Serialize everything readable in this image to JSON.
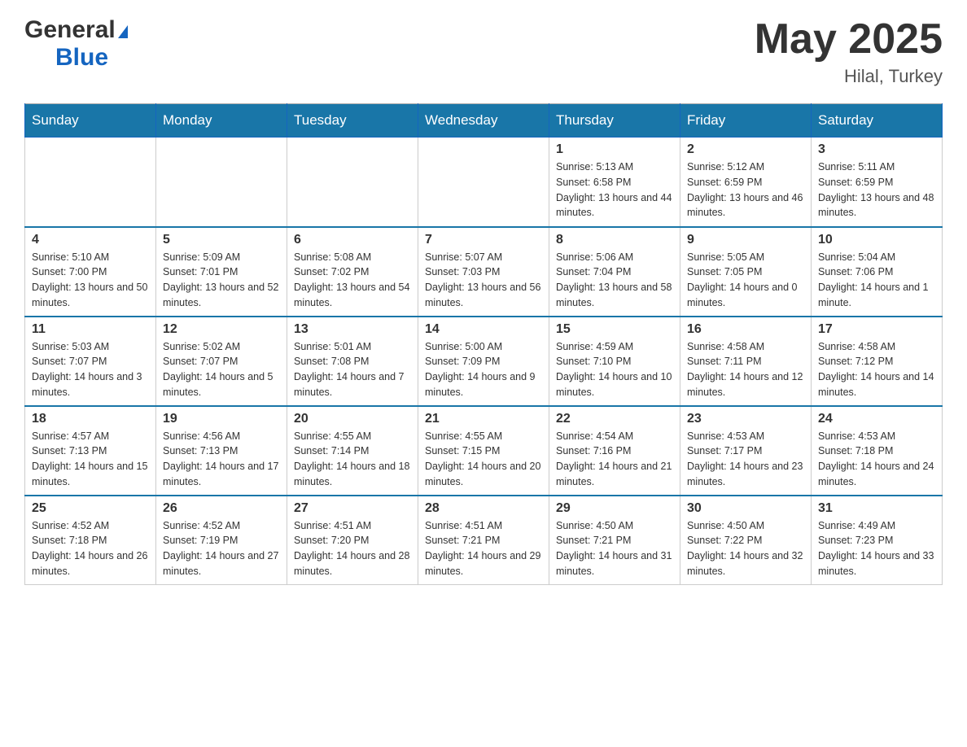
{
  "logo": {
    "general": "General",
    "blue": "Blue",
    "tagline": ""
  },
  "title": {
    "month_year": "May 2025",
    "location": "Hilal, Turkey"
  },
  "weekdays": [
    "Sunday",
    "Monday",
    "Tuesday",
    "Wednesday",
    "Thursday",
    "Friday",
    "Saturday"
  ],
  "weeks": [
    [
      {
        "day": "",
        "sunrise": "",
        "sunset": "",
        "daylight": ""
      },
      {
        "day": "",
        "sunrise": "",
        "sunset": "",
        "daylight": ""
      },
      {
        "day": "",
        "sunrise": "",
        "sunset": "",
        "daylight": ""
      },
      {
        "day": "",
        "sunrise": "",
        "sunset": "",
        "daylight": ""
      },
      {
        "day": "1",
        "sunrise": "Sunrise: 5:13 AM",
        "sunset": "Sunset: 6:58 PM",
        "daylight": "Daylight: 13 hours and 44 minutes."
      },
      {
        "day": "2",
        "sunrise": "Sunrise: 5:12 AM",
        "sunset": "Sunset: 6:59 PM",
        "daylight": "Daylight: 13 hours and 46 minutes."
      },
      {
        "day": "3",
        "sunrise": "Sunrise: 5:11 AM",
        "sunset": "Sunset: 6:59 PM",
        "daylight": "Daylight: 13 hours and 48 minutes."
      }
    ],
    [
      {
        "day": "4",
        "sunrise": "Sunrise: 5:10 AM",
        "sunset": "Sunset: 7:00 PM",
        "daylight": "Daylight: 13 hours and 50 minutes."
      },
      {
        "day": "5",
        "sunrise": "Sunrise: 5:09 AM",
        "sunset": "Sunset: 7:01 PM",
        "daylight": "Daylight: 13 hours and 52 minutes."
      },
      {
        "day": "6",
        "sunrise": "Sunrise: 5:08 AM",
        "sunset": "Sunset: 7:02 PM",
        "daylight": "Daylight: 13 hours and 54 minutes."
      },
      {
        "day": "7",
        "sunrise": "Sunrise: 5:07 AM",
        "sunset": "Sunset: 7:03 PM",
        "daylight": "Daylight: 13 hours and 56 minutes."
      },
      {
        "day": "8",
        "sunrise": "Sunrise: 5:06 AM",
        "sunset": "Sunset: 7:04 PM",
        "daylight": "Daylight: 13 hours and 58 minutes."
      },
      {
        "day": "9",
        "sunrise": "Sunrise: 5:05 AM",
        "sunset": "Sunset: 7:05 PM",
        "daylight": "Daylight: 14 hours and 0 minutes."
      },
      {
        "day": "10",
        "sunrise": "Sunrise: 5:04 AM",
        "sunset": "Sunset: 7:06 PM",
        "daylight": "Daylight: 14 hours and 1 minute."
      }
    ],
    [
      {
        "day": "11",
        "sunrise": "Sunrise: 5:03 AM",
        "sunset": "Sunset: 7:07 PM",
        "daylight": "Daylight: 14 hours and 3 minutes."
      },
      {
        "day": "12",
        "sunrise": "Sunrise: 5:02 AM",
        "sunset": "Sunset: 7:07 PM",
        "daylight": "Daylight: 14 hours and 5 minutes."
      },
      {
        "day": "13",
        "sunrise": "Sunrise: 5:01 AM",
        "sunset": "Sunset: 7:08 PM",
        "daylight": "Daylight: 14 hours and 7 minutes."
      },
      {
        "day": "14",
        "sunrise": "Sunrise: 5:00 AM",
        "sunset": "Sunset: 7:09 PM",
        "daylight": "Daylight: 14 hours and 9 minutes."
      },
      {
        "day": "15",
        "sunrise": "Sunrise: 4:59 AM",
        "sunset": "Sunset: 7:10 PM",
        "daylight": "Daylight: 14 hours and 10 minutes."
      },
      {
        "day": "16",
        "sunrise": "Sunrise: 4:58 AM",
        "sunset": "Sunset: 7:11 PM",
        "daylight": "Daylight: 14 hours and 12 minutes."
      },
      {
        "day": "17",
        "sunrise": "Sunrise: 4:58 AM",
        "sunset": "Sunset: 7:12 PM",
        "daylight": "Daylight: 14 hours and 14 minutes."
      }
    ],
    [
      {
        "day": "18",
        "sunrise": "Sunrise: 4:57 AM",
        "sunset": "Sunset: 7:13 PM",
        "daylight": "Daylight: 14 hours and 15 minutes."
      },
      {
        "day": "19",
        "sunrise": "Sunrise: 4:56 AM",
        "sunset": "Sunset: 7:13 PM",
        "daylight": "Daylight: 14 hours and 17 minutes."
      },
      {
        "day": "20",
        "sunrise": "Sunrise: 4:55 AM",
        "sunset": "Sunset: 7:14 PM",
        "daylight": "Daylight: 14 hours and 18 minutes."
      },
      {
        "day": "21",
        "sunrise": "Sunrise: 4:55 AM",
        "sunset": "Sunset: 7:15 PM",
        "daylight": "Daylight: 14 hours and 20 minutes."
      },
      {
        "day": "22",
        "sunrise": "Sunrise: 4:54 AM",
        "sunset": "Sunset: 7:16 PM",
        "daylight": "Daylight: 14 hours and 21 minutes."
      },
      {
        "day": "23",
        "sunrise": "Sunrise: 4:53 AM",
        "sunset": "Sunset: 7:17 PM",
        "daylight": "Daylight: 14 hours and 23 minutes."
      },
      {
        "day": "24",
        "sunrise": "Sunrise: 4:53 AM",
        "sunset": "Sunset: 7:18 PM",
        "daylight": "Daylight: 14 hours and 24 minutes."
      }
    ],
    [
      {
        "day": "25",
        "sunrise": "Sunrise: 4:52 AM",
        "sunset": "Sunset: 7:18 PM",
        "daylight": "Daylight: 14 hours and 26 minutes."
      },
      {
        "day": "26",
        "sunrise": "Sunrise: 4:52 AM",
        "sunset": "Sunset: 7:19 PM",
        "daylight": "Daylight: 14 hours and 27 minutes."
      },
      {
        "day": "27",
        "sunrise": "Sunrise: 4:51 AM",
        "sunset": "Sunset: 7:20 PM",
        "daylight": "Daylight: 14 hours and 28 minutes."
      },
      {
        "day": "28",
        "sunrise": "Sunrise: 4:51 AM",
        "sunset": "Sunset: 7:21 PM",
        "daylight": "Daylight: 14 hours and 29 minutes."
      },
      {
        "day": "29",
        "sunrise": "Sunrise: 4:50 AM",
        "sunset": "Sunset: 7:21 PM",
        "daylight": "Daylight: 14 hours and 31 minutes."
      },
      {
        "day": "30",
        "sunrise": "Sunrise: 4:50 AM",
        "sunset": "Sunset: 7:22 PM",
        "daylight": "Daylight: 14 hours and 32 minutes."
      },
      {
        "day": "31",
        "sunrise": "Sunrise: 4:49 AM",
        "sunset": "Sunset: 7:23 PM",
        "daylight": "Daylight: 14 hours and 33 minutes."
      }
    ]
  ]
}
